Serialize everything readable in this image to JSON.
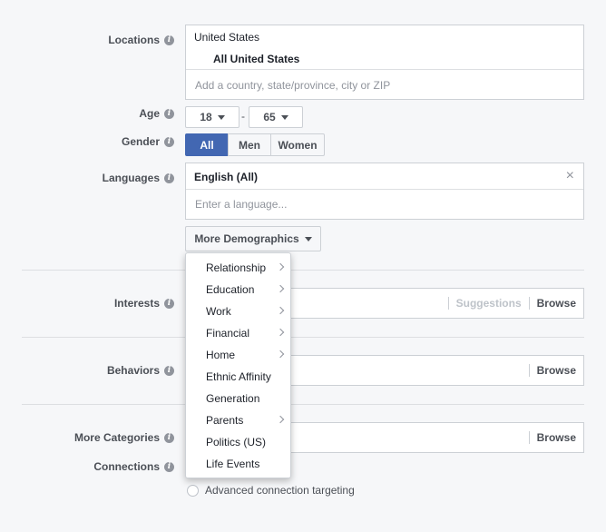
{
  "locations": {
    "label": "Locations",
    "selected_country": "United States",
    "selected_sub": "All United States",
    "placeholder": "Add a country, state/province, city or ZIP"
  },
  "age": {
    "label": "Age",
    "min": "18",
    "separator": "-",
    "max": "65"
  },
  "gender": {
    "label": "Gender",
    "options": [
      "All",
      "Men",
      "Women"
    ],
    "selected": "All"
  },
  "languages": {
    "label": "Languages",
    "selected": "English (All)",
    "remove_glyph": "×",
    "placeholder": "Enter a language..."
  },
  "more_demographics": {
    "label": "More Demographics",
    "menu": [
      {
        "label": "Relationship",
        "has_submenu": true
      },
      {
        "label": "Education",
        "has_submenu": true
      },
      {
        "label": "Work",
        "has_submenu": true
      },
      {
        "label": "Financial",
        "has_submenu": true
      },
      {
        "label": "Home",
        "has_submenu": true
      },
      {
        "label": "Ethnic Affinity",
        "has_submenu": false
      },
      {
        "label": "Generation",
        "has_submenu": false
      },
      {
        "label": "Parents",
        "has_submenu": true
      },
      {
        "label": "Politics (US)",
        "has_submenu": false
      },
      {
        "label": "Life Events",
        "has_submenu": false
      }
    ]
  },
  "interests": {
    "label": "Interests",
    "suggestions": "Suggestions",
    "browse": "Browse"
  },
  "behaviors": {
    "label": "Behaviors",
    "browse": "Browse"
  },
  "more_categories": {
    "label": "More Categories",
    "browse": "Browse"
  },
  "connections": {
    "label": "Connections",
    "advanced": "Advanced connection targeting"
  },
  "icons": {
    "info": "i"
  },
  "colors": {
    "accent": "#4267b2",
    "background": "#f6f7f9",
    "border": "#ccd0d5"
  }
}
